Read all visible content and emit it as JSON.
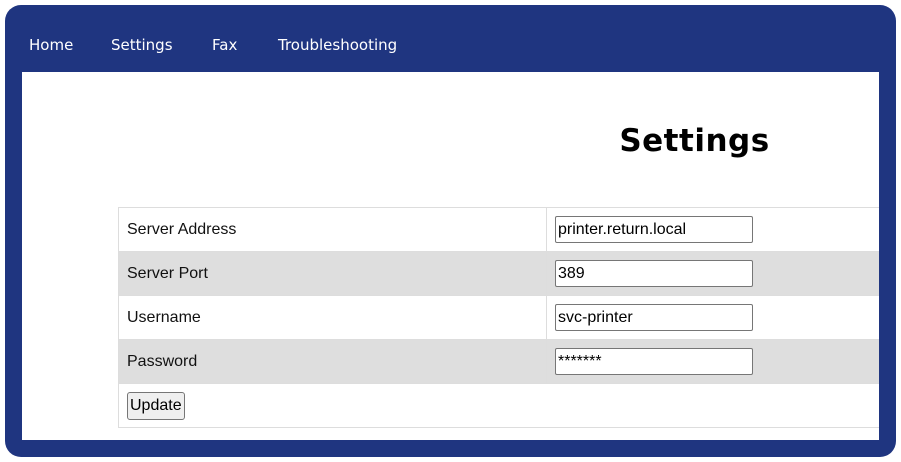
{
  "nav": {
    "items": [
      {
        "label": "Home"
      },
      {
        "label": "Settings"
      },
      {
        "label": "Fax"
      },
      {
        "label": "Troubleshooting"
      }
    ]
  },
  "page": {
    "title": "Settings"
  },
  "form": {
    "rows": [
      {
        "label": "Server Address",
        "value": "printer.return.local"
      },
      {
        "label": "Server Port",
        "value": "389"
      },
      {
        "label": "Username",
        "value": "svc-printer"
      },
      {
        "label": "Password",
        "value": "*******"
      }
    ],
    "update_label": "Update"
  },
  "colors": {
    "frame": "#1f3580",
    "row_shade": "#dedede"
  }
}
